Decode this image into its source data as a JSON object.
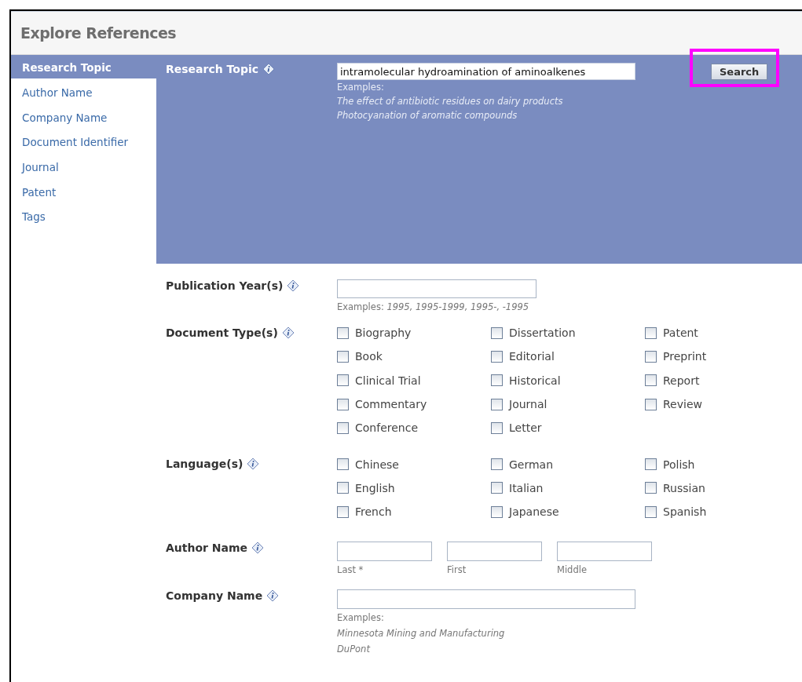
{
  "page_title": "Explore References",
  "sidebar": {
    "items": [
      {
        "label": "Research Topic",
        "selected": true
      },
      {
        "label": "Author Name",
        "selected": false
      },
      {
        "label": "Company Name",
        "selected": false
      },
      {
        "label": "Document Identifier",
        "selected": false
      },
      {
        "label": "Journal",
        "selected": false
      },
      {
        "label": "Patent",
        "selected": false
      },
      {
        "label": "Tags",
        "selected": false
      }
    ]
  },
  "research_topic": {
    "label": "Research Topic",
    "value": "intramolecular hydroamination of aminoalkenes",
    "examples_label": "Examples:",
    "examples": [
      "The effect of antibiotic residues on dairy products",
      "Photocyanation of aromatic compounds"
    ]
  },
  "search_button": {
    "label": "Search",
    "highlighted": true
  },
  "publication_years": {
    "label": "Publication Year(s)",
    "examples_label": "Examples:",
    "examples": "1995, 1995-1999, 1995-, -1995"
  },
  "document_types": {
    "label": "Document Type(s)",
    "columns": [
      [
        {
          "label": "Biography",
          "checked": false
        },
        {
          "label": "Book",
          "checked": false
        },
        {
          "label": "Clinical Trial",
          "checked": false
        },
        {
          "label": "Commentary",
          "checked": false
        },
        {
          "label": "Conference",
          "checked": false
        }
      ],
      [
        {
          "label": "Dissertation",
          "checked": false
        },
        {
          "label": "Editorial",
          "checked": false
        },
        {
          "label": "Historical",
          "checked": false
        },
        {
          "label": "Journal",
          "checked": false
        },
        {
          "label": "Letter",
          "checked": false
        }
      ],
      [
        {
          "label": "Patent",
          "checked": false
        },
        {
          "label": "Preprint",
          "checked": false
        },
        {
          "label": "Report",
          "checked": false
        },
        {
          "label": "Review",
          "checked": false
        }
      ]
    ]
  },
  "languages": {
    "label": "Language(s)",
    "columns": [
      [
        {
          "label": "Chinese",
          "checked": false
        },
        {
          "label": "English",
          "checked": false
        },
        {
          "label": "French",
          "checked": false
        }
      ],
      [
        {
          "label": "German",
          "checked": false
        },
        {
          "label": "Italian",
          "checked": false
        },
        {
          "label": "Japanese",
          "checked": false
        }
      ],
      [
        {
          "label": "Polish",
          "checked": false
        },
        {
          "label": "Russian",
          "checked": false
        },
        {
          "label": "Spanish",
          "checked": false
        }
      ]
    ]
  },
  "author_name": {
    "label": "Author Name",
    "fields": [
      {
        "caption": "Last *"
      },
      {
        "caption": "First"
      },
      {
        "caption": "Middle"
      }
    ]
  },
  "company_name": {
    "label": "Company Name",
    "examples_label": "Examples:",
    "examples": [
      "Minnesota Mining and Manufacturing",
      "DuPont"
    ]
  }
}
